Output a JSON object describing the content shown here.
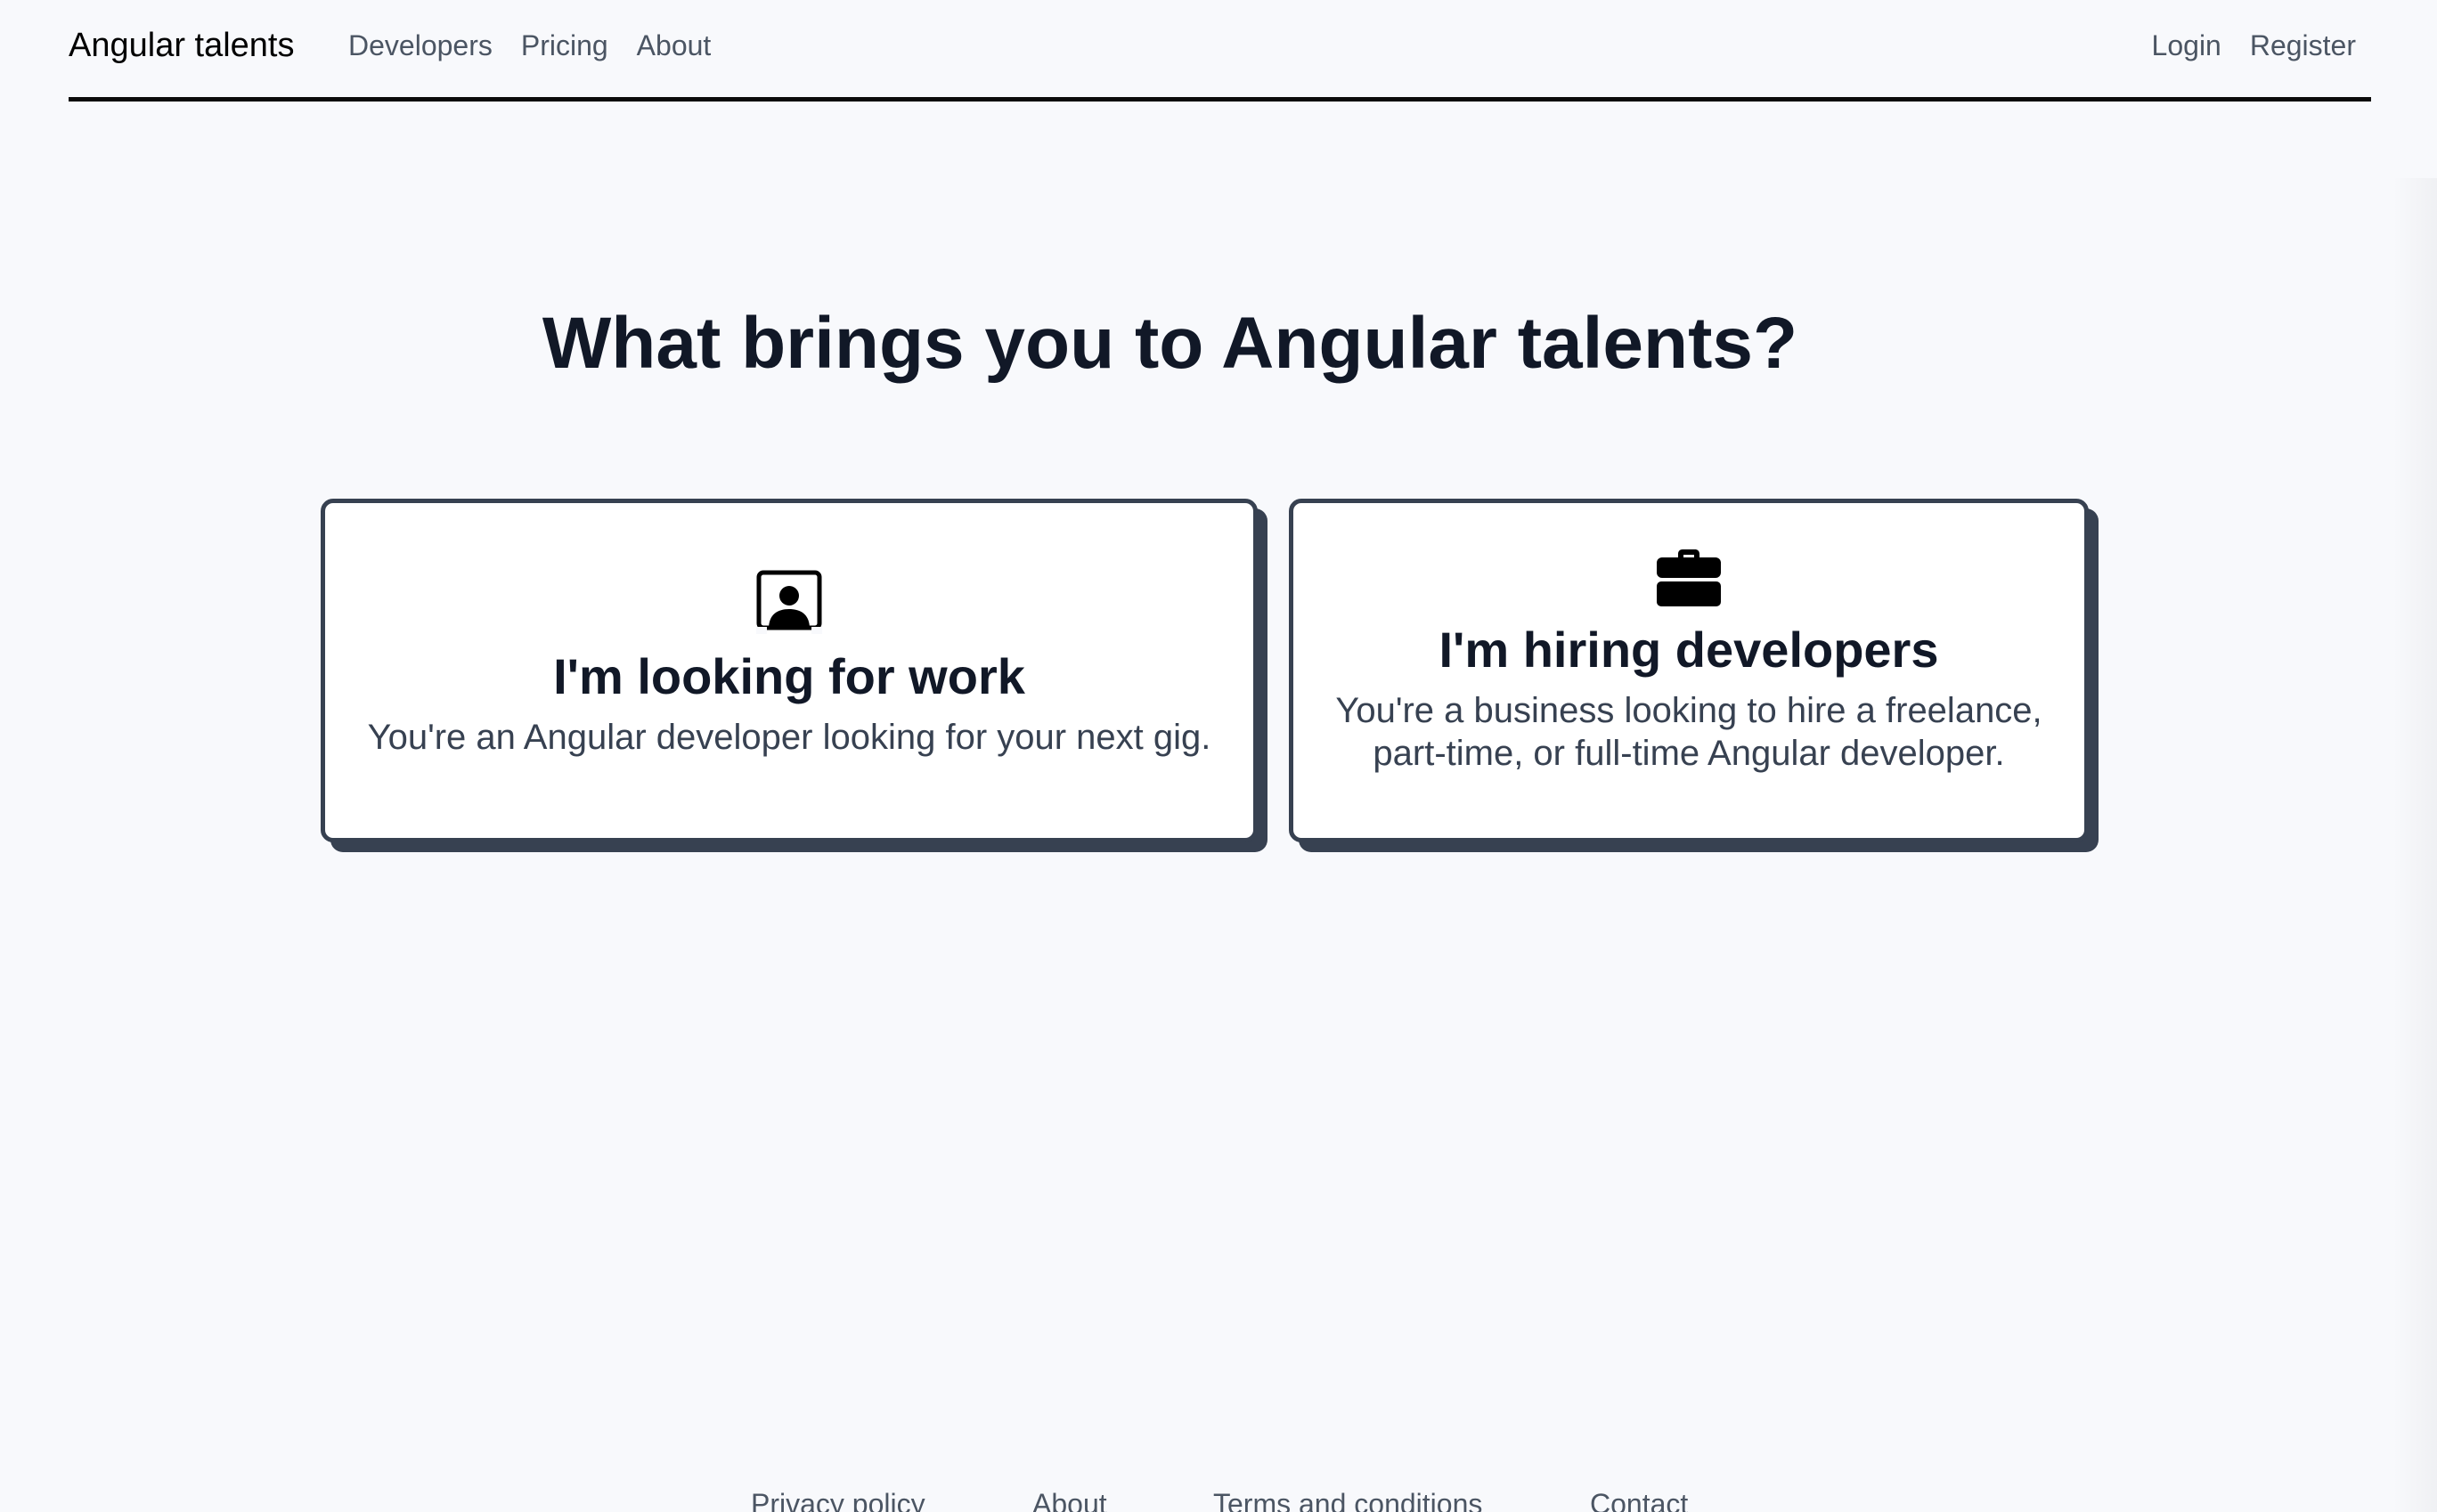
{
  "header": {
    "brand": "Angular talents",
    "nav_left": [
      {
        "label": "Developers"
      },
      {
        "label": "Pricing"
      },
      {
        "label": "About"
      }
    ],
    "nav_right": [
      {
        "label": "Login"
      },
      {
        "label": "Register"
      }
    ]
  },
  "main": {
    "title": "What brings you to Angular talents?",
    "cards": [
      {
        "icon": "person-portrait-icon",
        "heading": "I'm looking for work",
        "text": "You're an Angular developer looking for your next gig."
      },
      {
        "icon": "briefcase-icon",
        "heading": "I'm hiring developers",
        "text": "You're a business looking to hire a freelance, part-time, or full-time Angular developer."
      }
    ]
  },
  "footer": {
    "links": [
      {
        "label": "Privacy policy"
      },
      {
        "label": "About"
      },
      {
        "label": "Terms and conditions"
      },
      {
        "label": "Contact"
      }
    ]
  },
  "colors": {
    "background": "#f8f9fc",
    "card_border": "#374151",
    "heading": "#111827",
    "muted_text": "#4b5563"
  }
}
